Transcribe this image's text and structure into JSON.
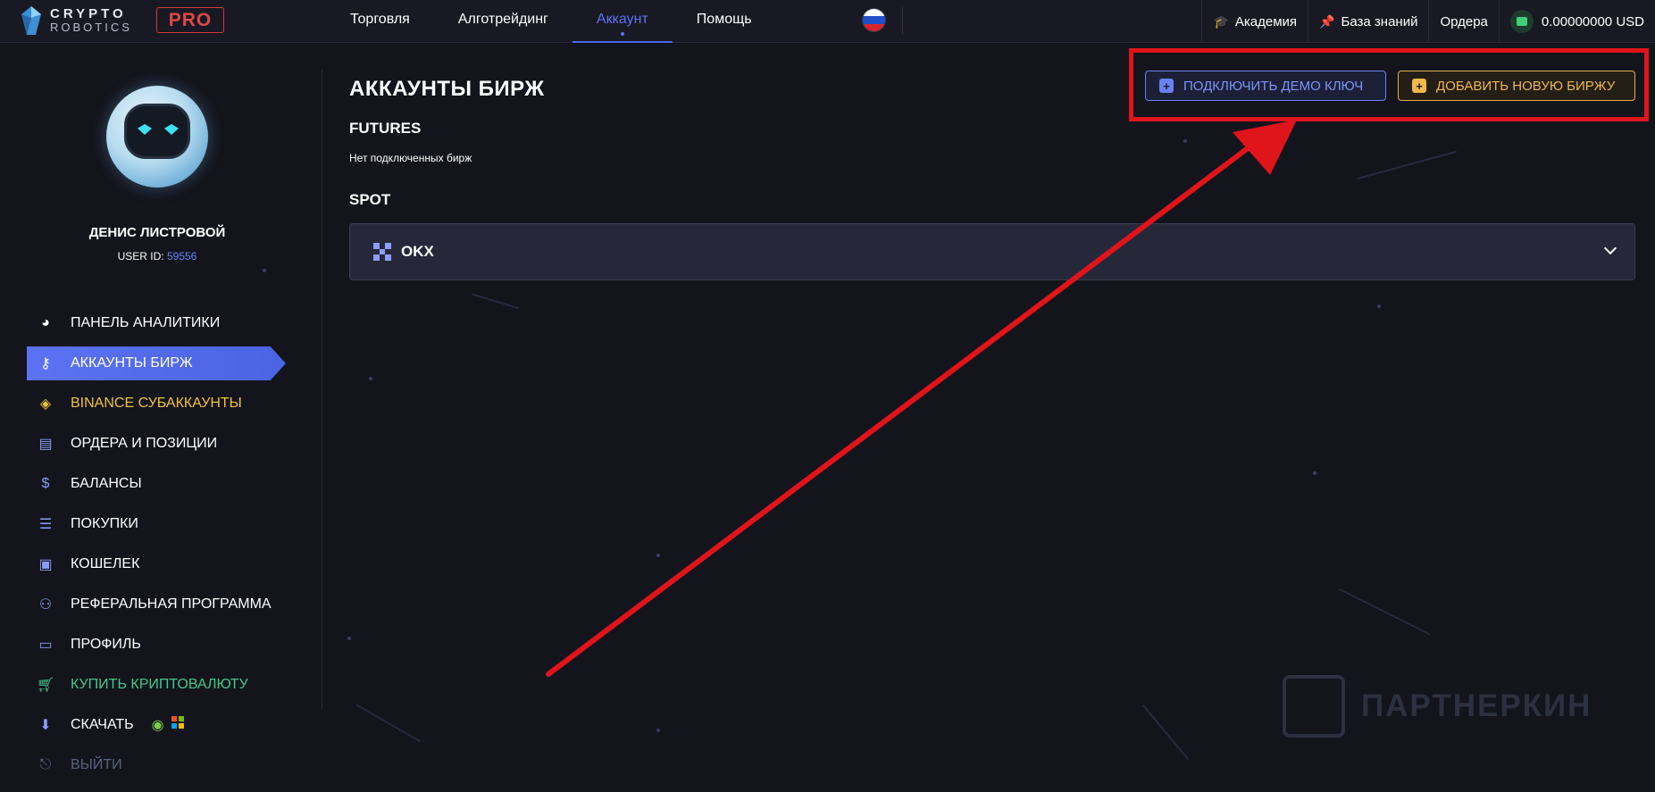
{
  "app": {
    "logo_line1": "CRYPTO",
    "logo_line2": "ROBOTICS",
    "pro_badge": "PRO"
  },
  "topnav": {
    "items": [
      {
        "label": "Торговля",
        "active": false
      },
      {
        "label": "Алготрейдинг",
        "active": false
      },
      {
        "label": "Аккаунт",
        "active": true
      },
      {
        "label": "Помощь",
        "active": false
      }
    ],
    "language_flag": "russian-flag-icon",
    "right": {
      "academy": "Академия",
      "knowledge_base": "База знаний",
      "orders": "Ордера",
      "balance": "0.00000000 USD"
    }
  },
  "user": {
    "name": "ДЕНИС ЛИСТРОВОЙ",
    "id_label": "USER ID:",
    "id_value": "59556"
  },
  "sidebar": {
    "items": [
      {
        "label": "ПАНЕЛЬ АНАЛИТИКИ",
        "icon": "pie-chart-icon"
      },
      {
        "label": "АККАУНТЫ БИРЖ",
        "icon": "key-icon",
        "active": true
      },
      {
        "label": "BINANCE СУБАККАУНТЫ",
        "icon": "binance-icon"
      },
      {
        "label": "ОРДЕРА И ПОЗИЦИИ",
        "icon": "orders-icon"
      },
      {
        "label": "БАЛАНСЫ",
        "icon": "money-bag-icon"
      },
      {
        "label": "ПОКУПКИ",
        "icon": "receipt-icon"
      },
      {
        "label": "КОШЕЛЕК",
        "icon": "wallet-icon"
      },
      {
        "label": "РЕФЕРАЛЬНАЯ ПРОГРАММА",
        "icon": "users-icon"
      },
      {
        "label": "ПРОФИЛЬ",
        "icon": "id-card-icon"
      },
      {
        "label": "КУПИТЬ КРИПТОВАЛЮТУ",
        "icon": "cart-icon"
      },
      {
        "label": "СКАЧАТЬ",
        "icon": "download-icon"
      },
      {
        "label": "ВЫЙТИ",
        "icon": "logout-icon"
      }
    ]
  },
  "main": {
    "title": "АККАУНТЫ БИРЖ",
    "futures_heading": "FUTURES",
    "futures_empty": "Нет подключенных бирж",
    "spot_heading": "SPOT",
    "spot_exchanges": [
      {
        "name": "OKX"
      }
    ],
    "connect_demo_button": "ПОДКЛЮЧИТЬ ДЕМО КЛЮЧ",
    "add_exchange_button": "ДОБАВИТЬ НОВУЮ БИРЖУ"
  },
  "watermark": "ПАРТНЕРКИН",
  "colors": {
    "background": "#13141c",
    "accent": "#4e67ea",
    "binance": "#f0c23a",
    "buy": "#43c98a",
    "demo_button": "#6b80f2",
    "add_button": "#f0b84a",
    "annotation": "#e0141b"
  }
}
